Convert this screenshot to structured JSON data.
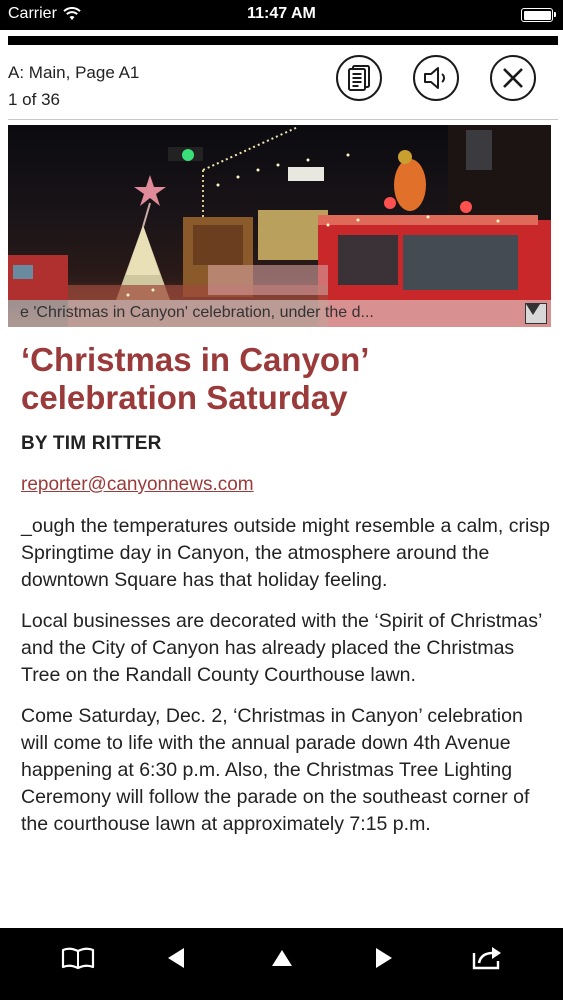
{
  "status_bar": {
    "carrier": "Carrier",
    "time": "11:47 AM",
    "icons": [
      "wifi-icon",
      "battery-icon"
    ]
  },
  "header": {
    "section": "A: Main, Page A1",
    "page_count": "1 of 36",
    "buttons": [
      "article-text-icon",
      "speaker-icon",
      "close-icon"
    ]
  },
  "photo": {
    "caption": "e 'Christmas in Canyon' celebration, under the d..."
  },
  "article": {
    "headline": "‘Christmas in Canyon’ celebration Saturday",
    "byline": "BY TIM RITTER",
    "email": "reporter@canyonnews.com",
    "paragraphs": [
      "_ough the temperatures outside might resemble a calm, crisp Springtime day in Canyon, the atmosphere around the downtown Square has that holiday feeling.",
      "Local businesses are decorated with the ‘Spirit of Christmas’ and the City of Canyon has already placed the Christmas Tree on the Randall County Courthouse lawn.",
      "Come Saturday, Dec. 2, ‘Christmas in Canyon’ celebration will come to life with the annual parade down 4th Avenue happening at 6:30 p.m. Also, the Christmas Tree Lighting Ceremony will follow the parade on the southeast corner of the courthouse lawn at approximately 7:15 p.m."
    ]
  },
  "toolbar": {
    "buttons": [
      "book-icon",
      "previous-icon",
      "up-icon",
      "next-icon",
      "share-icon"
    ]
  },
  "colors": {
    "accent": "#9b3a3a",
    "bars": "#000000"
  }
}
